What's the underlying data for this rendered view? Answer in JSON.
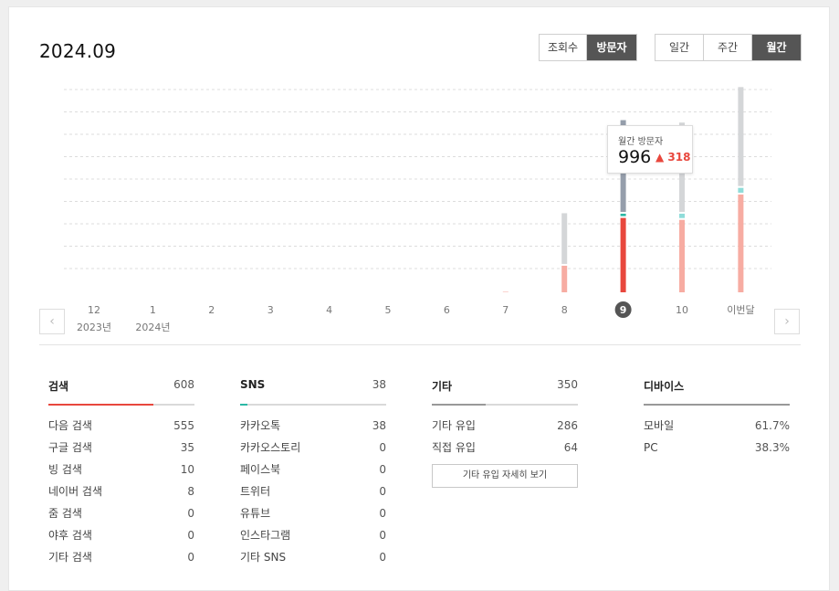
{
  "header": {
    "title": "2024.09"
  },
  "metric_toggle": [
    {
      "label": "조회수",
      "active": false
    },
    {
      "label": "방문자",
      "active": true
    }
  ],
  "period_toggle": [
    {
      "label": "일간",
      "active": false
    },
    {
      "label": "주간",
      "active": false
    },
    {
      "label": "월간",
      "active": true
    }
  ],
  "nav": {
    "prev_icon": "chevron-left-icon",
    "next_icon": "chevron-right-icon"
  },
  "tooltip": {
    "label": "월간 방문자",
    "value": "996",
    "delta": "318"
  },
  "colors": {
    "grey_dark": "#959eab",
    "grey_light": "#d4d6d8",
    "teal_dark": "#2bb8a5",
    "teal_light": "#8fdcd9",
    "red_dark": "#e8473d",
    "red_light": "#f7aca2",
    "selected_marker": "#555555"
  },
  "chart_data": {
    "type": "bar",
    "stacked": true,
    "categories": [
      "12",
      "1",
      "2",
      "3",
      "4",
      "5",
      "6",
      "7",
      "8",
      "9",
      "10",
      "이번달"
    ],
    "year_labels": [
      "2023년",
      "2024년",
      "",
      "",
      "",
      "",
      "",
      "",
      "",
      "",
      "",
      ""
    ],
    "selected": "9",
    "series": [
      {
        "values": [
          0,
          0,
          0,
          0,
          0,
          0,
          0,
          2,
          110,
          308,
          300,
          405
        ]
      },
      {
        "values": [
          0,
          0,
          0,
          0,
          0,
          0,
          0,
          0,
          0,
          10,
          18,
          20
        ]
      },
      {
        "values": [
          0,
          0,
          0,
          0,
          0,
          0,
          0,
          0,
          210,
          380,
          370,
          410
        ]
      }
    ],
    "grid": true
  },
  "stats": [
    {
      "title": "검색",
      "total": "608",
      "fill": 0.72,
      "color": "#e8473d",
      "rows": [
        {
          "label": "다음 검색",
          "value": "555"
        },
        {
          "label": "구글 검색",
          "value": "35"
        },
        {
          "label": "빙 검색",
          "value": "10"
        },
        {
          "label": "네이버 검색",
          "value": "8"
        },
        {
          "label": "줌 검색",
          "value": "0"
        },
        {
          "label": "야후 검색",
          "value": "0"
        },
        {
          "label": "기타 검색",
          "value": "0"
        }
      ]
    },
    {
      "title": "SNS",
      "total": "38",
      "fill": 0.05,
      "color": "#2bb8a5",
      "rows": [
        {
          "label": "카카오톡",
          "value": "38"
        },
        {
          "label": "카카오스토리",
          "value": "0"
        },
        {
          "label": "페이스북",
          "value": "0"
        },
        {
          "label": "트위터",
          "value": "0"
        },
        {
          "label": "유튜브",
          "value": "0"
        },
        {
          "label": "인스타그램",
          "value": "0"
        },
        {
          "label": "기타 SNS",
          "value": "0"
        }
      ]
    },
    {
      "title": "기타",
      "total": "350",
      "fill": 0.37,
      "color": "#999999",
      "rows": [
        {
          "label": "기타 유입",
          "value": "286"
        },
        {
          "label": "직접 유입",
          "value": "64"
        }
      ],
      "button": "기타 유입 자세히 보기"
    },
    {
      "title": "디바이스",
      "total": "",
      "fill": 1,
      "color": "#999999",
      "rows": [
        {
          "label": "모바일",
          "value": "61.7%"
        },
        {
          "label": "PC",
          "value": "38.3%"
        }
      ]
    }
  ]
}
